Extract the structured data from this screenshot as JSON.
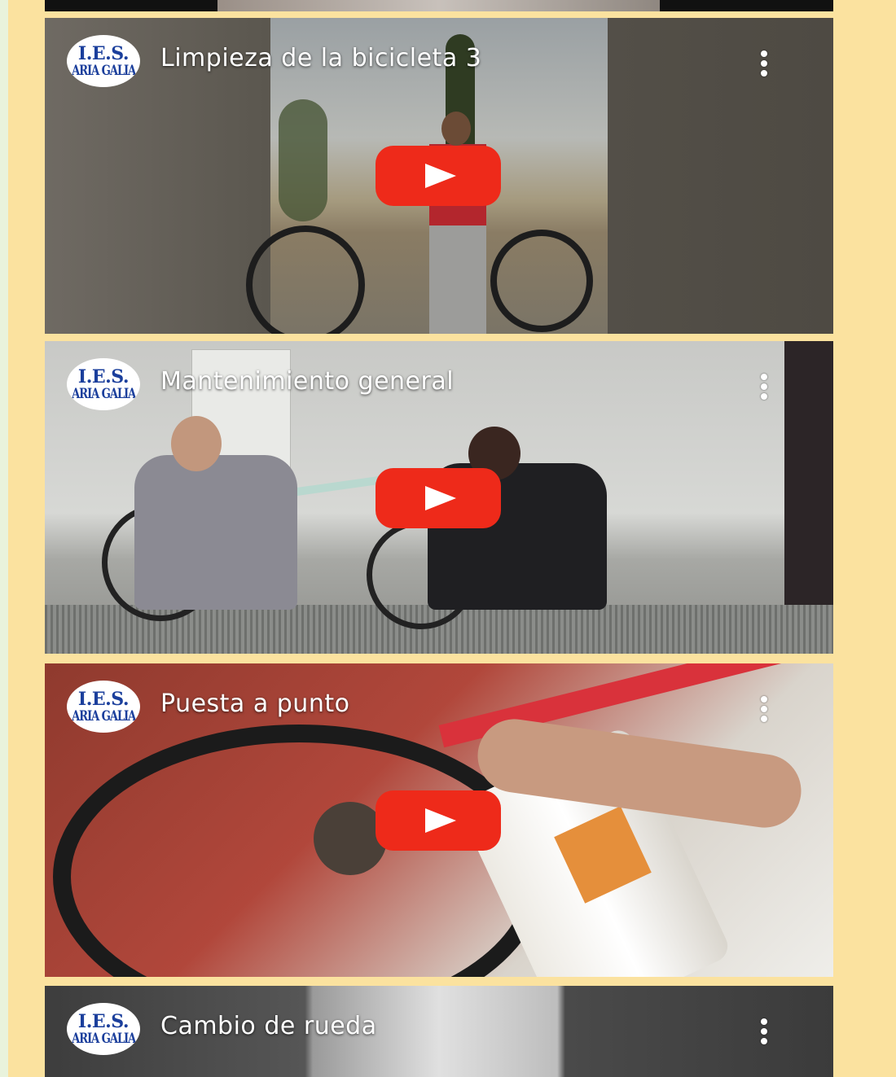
{
  "page": {
    "background": "#fbe29f"
  },
  "channel_logo": {
    "line1": "I.E.S.",
    "line2": "ARIA GALIA",
    "color": "#1b3f9c"
  },
  "videos": [
    {
      "title": "Limpieza de la bicicleta 3"
    },
    {
      "title": "Mantenimiento general"
    },
    {
      "title": "Puesta a punto"
    },
    {
      "title": "Cambio de rueda"
    }
  ],
  "icons": {
    "menu": "more-vert-icon",
    "play": "youtube-play-icon"
  },
  "colors": {
    "play_button": "#ee2a1a",
    "title_text": "#ffffff"
  }
}
